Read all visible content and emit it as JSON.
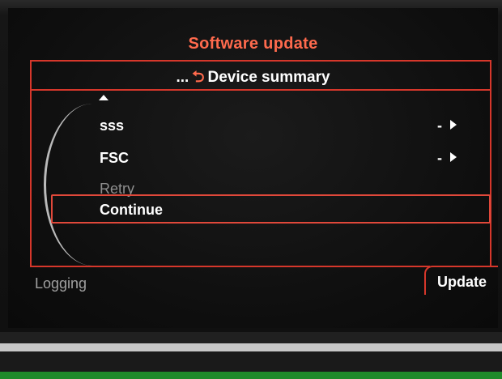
{
  "screen": {
    "title": "Software update",
    "subheader": {
      "ellipsis": "...",
      "back_icon": "return-arrow-icon",
      "label": "Device summary"
    },
    "items": [
      {
        "label": "sss",
        "value": "-"
      },
      {
        "label": "FSC",
        "value": "-"
      },
      {
        "label": "Retry"
      },
      {
        "label": "Continue",
        "selected": true
      }
    ],
    "footer": {
      "left_label": "Logging",
      "right_tab": "Update"
    }
  },
  "colors": {
    "accent": "#d6372b",
    "title": "#ff6a4d",
    "text": "#ffffff",
    "dim_text": "#8f8f8f"
  }
}
